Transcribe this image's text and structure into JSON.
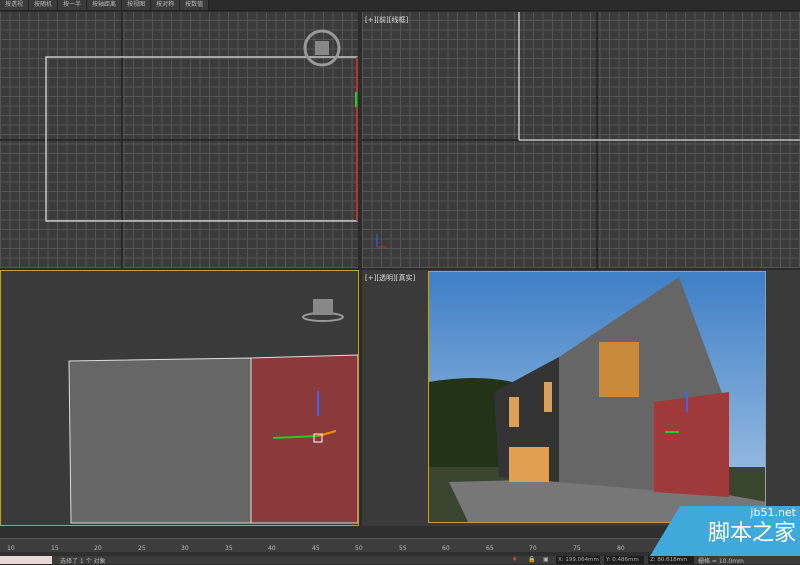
{
  "toolbar": {
    "buttons": [
      "按透视",
      "按随机",
      "按一半",
      "按轴距离",
      "按视图",
      "按对称",
      "按数值"
    ]
  },
  "viewports": {
    "front": "[+][前][线框]",
    "perspective": "[+][透明][真实]"
  },
  "timeline": {
    "ticks": [
      "10",
      "15",
      "20",
      "25",
      "30",
      "35",
      "40",
      "45",
      "50",
      "55",
      "60",
      "65",
      "70",
      "75",
      "80"
    ]
  },
  "status": {
    "message": "选择了 1 个 对象",
    "x": "X: 199.064mm",
    "y": "Y: 0.486mm",
    "z": "Z: 80.618mm",
    "grid": "栅格 = 10.0mm"
  },
  "watermark": {
    "site": "jb51.net",
    "name": "脚本之家"
  },
  "colors": {
    "active_border": "#b8a040",
    "sky": "#4a86c8"
  }
}
